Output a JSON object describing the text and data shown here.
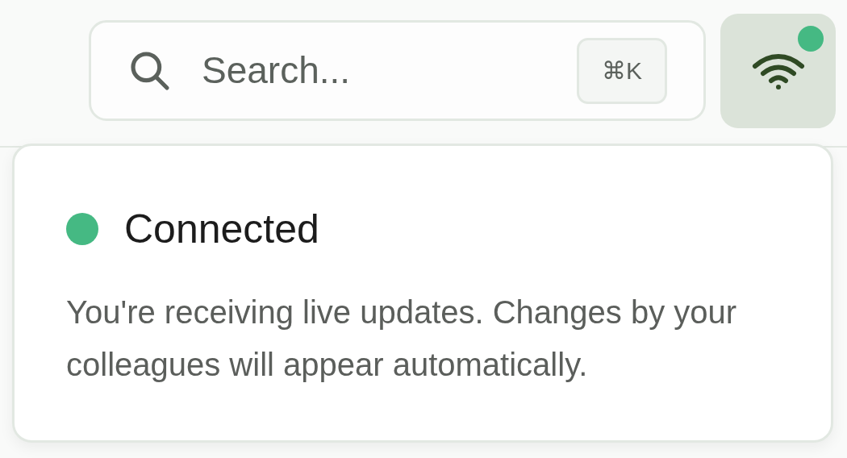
{
  "search": {
    "placeholder": "Search...",
    "shortcut": "⌘K"
  },
  "connection_button": {
    "online": true
  },
  "popover": {
    "online": true,
    "title": "Connected",
    "description": "You're receiving live updates. Changes by your colleagues will appear automatically."
  }
}
